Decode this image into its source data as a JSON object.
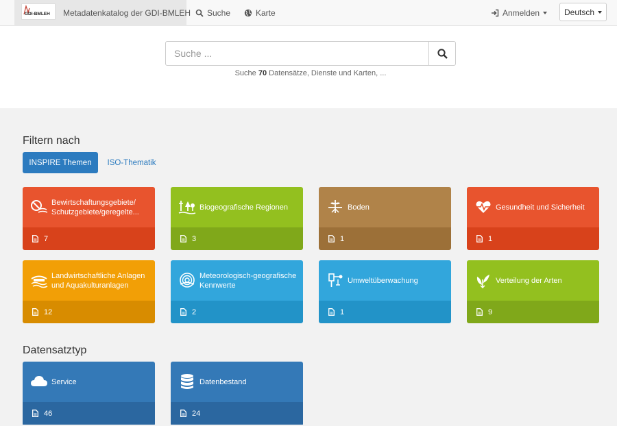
{
  "navbar": {
    "logo_text": "GDI-BMLEH",
    "title": "Metadatenkatalog der GDI-BMLEH",
    "links": [
      {
        "label": "Suche",
        "icon": "search-icon"
      },
      {
        "label": "Karte",
        "icon": "globe-icon"
      }
    ],
    "login_label": "Anmelden",
    "language": "Deutsch"
  },
  "search": {
    "placeholder": "Suche ...",
    "hint_prefix": "Suche",
    "hint_count": "70",
    "hint_suffix": "Datensätze, Dienste und Karten, ..."
  },
  "filter": {
    "title": "Filtern nach",
    "tabs": [
      {
        "label": "INSPIRE Themen",
        "active": true
      },
      {
        "label": "ISO-Thematik",
        "active": false
      }
    ],
    "cards": [
      {
        "label": "Bewirtschaftungsgebiete/ Schutzgebiete/geregelte...",
        "count": "7",
        "color": "#e8542e",
        "icon": "restricted-zones-icon"
      },
      {
        "label": "Biogeografische Regionen",
        "count": "3",
        "color": "#93c01f",
        "icon": "bio-regions-icon"
      },
      {
        "label": "Boden",
        "count": "1",
        "color": "#b08349",
        "icon": "soil-icon"
      },
      {
        "label": "Gesundheit und Sicherheit",
        "count": "1",
        "color": "#e8542e",
        "icon": "health-icon"
      },
      {
        "label": "Landwirtschaftliche Anlagen und Aquakulturanlagen",
        "count": "12",
        "color": "#f29f06",
        "icon": "agriculture-icon"
      },
      {
        "label": "Meteorologisch-geografische Kennwerte",
        "count": "2",
        "color": "#32a6dc",
        "icon": "meteorology-icon"
      },
      {
        "label": "Umweltüberwachung",
        "count": "1",
        "color": "#32a6dc",
        "icon": "monitoring-icon"
      },
      {
        "label": "Verteilung der Arten",
        "count": "9",
        "color": "#93c01f",
        "icon": "species-icon"
      }
    ]
  },
  "datatype": {
    "title": "Datensatztyp",
    "cards": [
      {
        "label": "Service",
        "count": "46",
        "color": "#3479b7",
        "icon": "cloud-icon"
      },
      {
        "label": "Datenbestand",
        "count": "24",
        "color": "#3479b7",
        "icon": "database-icon"
      }
    ]
  }
}
